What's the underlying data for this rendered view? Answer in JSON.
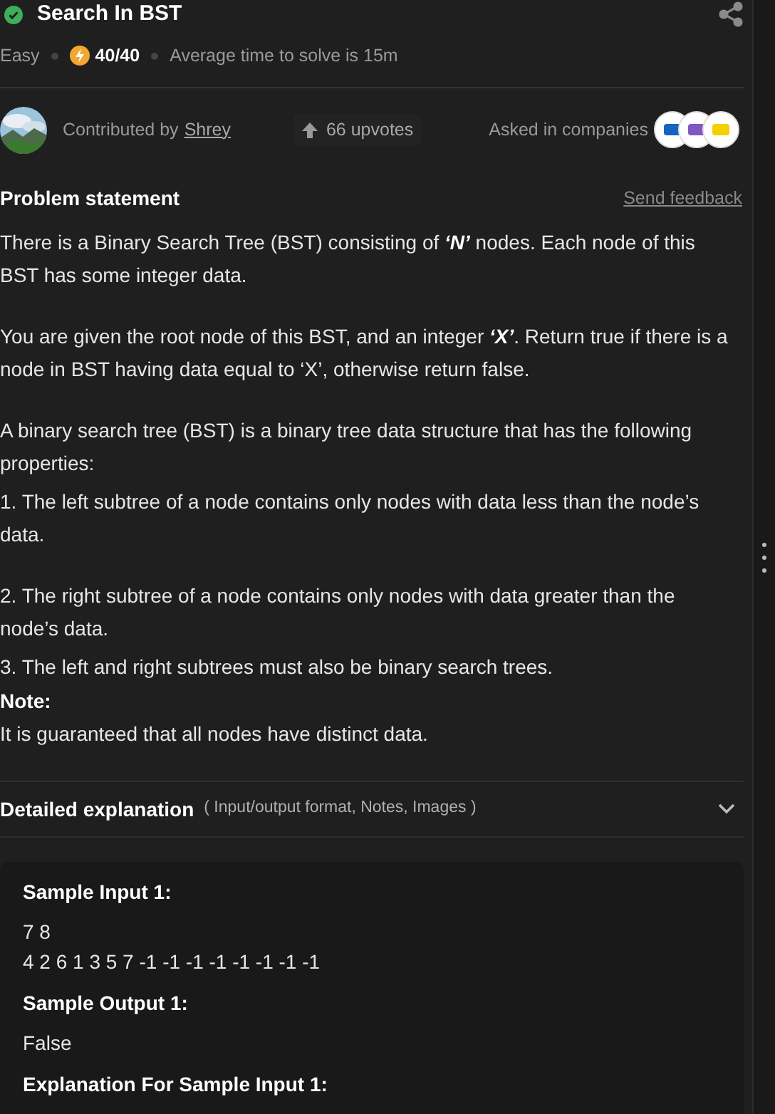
{
  "title": "Search In BST",
  "solved": true,
  "meta": {
    "difficulty": "Easy",
    "score": "40/40",
    "avg_time": "Average time to solve is 15m"
  },
  "contributor": {
    "label": "Contributed by",
    "name": "Shrey",
    "upvotes": "66 upvotes",
    "companies_label": "Asked in companies",
    "companies": [
      {
        "color": "#1565c0"
      },
      {
        "color": "#7e57c2"
      },
      {
        "color": "#f5d000"
      }
    ]
  },
  "problem": {
    "heading": "Problem statement",
    "feedback": "Send feedback",
    "paragraphs": [
      {
        "kind": "text",
        "text": "There is a Binary Search Tree (BST) consisting of **‘N’** nodes. Each node of this BST has some integer data."
      },
      {
        "kind": "text",
        "text": "You are given the root node of this BST, and an integer **‘X’**. Return true if there is a node in BST having data equal to ‘X’, otherwise return false."
      },
      {
        "kind": "text",
        "text": "A binary search tree (BST) is a binary tree data structure that has the following properties:"
      },
      {
        "kind": "tight",
        "text": "1. The left subtree of a node contains only nodes with data less than the node’s data."
      },
      {
        "kind": "text",
        "text": "2. The right subtree of a node contains only nodes with data greater than the node’s data."
      },
      {
        "kind": "tight",
        "text": "3. The left and right subtrees must also be binary search trees."
      },
      {
        "kind": "heading",
        "text": "Note:"
      },
      {
        "kind": "text",
        "text": "It is guaranteed that all nodes have distinct data."
      }
    ]
  },
  "details": {
    "title": "Detailed explanation",
    "subtitle": "( Input/output format, Notes, Images )",
    "expanded": false
  },
  "sample": [
    {
      "kind": "heading",
      "text": "Sample Input 1:"
    },
    {
      "kind": "lines",
      "lines": [
        "7 8",
        "4 2 6 1 3 5 7 -1 -1 -1 -1 -1 -1 -1 -1"
      ]
    },
    {
      "kind": "heading",
      "text": "Sample Output 1:"
    },
    {
      "kind": "lines",
      "lines": [
        "False"
      ]
    },
    {
      "kind": "heading",
      "text": "Explanation For Sample Input 1:"
    }
  ]
}
